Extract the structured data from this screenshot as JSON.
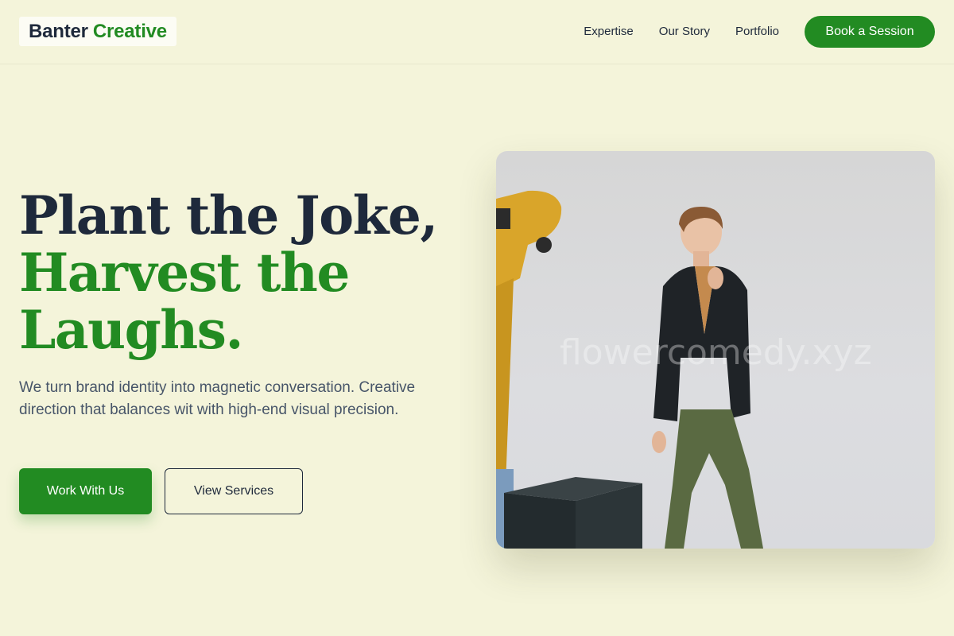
{
  "brand": {
    "part1": "Banter",
    "part2": "Creative"
  },
  "nav": {
    "items": [
      "Expertise",
      "Our Story",
      "Portfolio"
    ],
    "cta": "Book a Session"
  },
  "hero": {
    "headline_line1": "Plant the Joke,",
    "headline_line2": "Harvest the",
    "headline_line3": "Laughs.",
    "subtitle": "We turn brand identity into magnetic conversation. Creative direction that balances wit with high-end visual precision.",
    "primary_button": "Work With Us",
    "secondary_button": "View Services",
    "image_watermark": "flowercomedy.xyz"
  },
  "colors": {
    "accent": "#228b22",
    "dark": "#1e293b",
    "background": "#f4f4da"
  }
}
